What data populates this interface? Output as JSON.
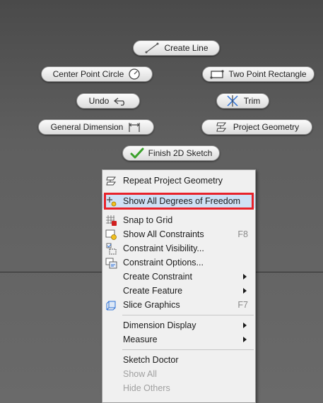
{
  "marking_menu": {
    "create_line": "Create Line",
    "center_point_circle": "Center Point Circle",
    "two_point_rectangle": "Two Point Rectangle",
    "undo": "Undo",
    "trim": "Trim",
    "general_dimension": "General Dimension",
    "project_geometry": "Project Geometry",
    "finish_2d_sketch": "Finish 2D Sketch"
  },
  "context_menu": {
    "items": [
      {
        "label": "Repeat Project Geometry",
        "icon": "project-geometry-icon"
      },
      {
        "label": "Show All Degrees of Freedom",
        "icon": "degrees-of-freedom-icon",
        "highlighted": true
      },
      {
        "label": "Snap to Grid",
        "icon": "snap-grid-icon"
      },
      {
        "label": "Show All Constraints",
        "shortcut": "F8",
        "icon": "show-constraints-icon"
      },
      {
        "label": "Constraint Visibility...",
        "icon": "constraint-visibility-icon"
      },
      {
        "label": "Constraint Options...",
        "icon": "constraint-options-icon"
      },
      {
        "label": "Create Constraint",
        "submenu": true
      },
      {
        "label": "Create Feature",
        "submenu": true
      },
      {
        "label": "Slice Graphics",
        "shortcut": "F7",
        "icon": "slice-graphics-icon"
      },
      {
        "label": "Dimension Display",
        "submenu": true
      },
      {
        "label": "Measure",
        "submenu": true
      },
      {
        "label": "Sketch Doctor"
      },
      {
        "label": "Show All",
        "disabled": true
      },
      {
        "label": "Hide Others",
        "disabled": true
      }
    ]
  },
  "colors": {
    "highlight_border": "#e8222a",
    "highlight_fill": "#cfe1f5",
    "finish_check": "#3aa12a"
  }
}
